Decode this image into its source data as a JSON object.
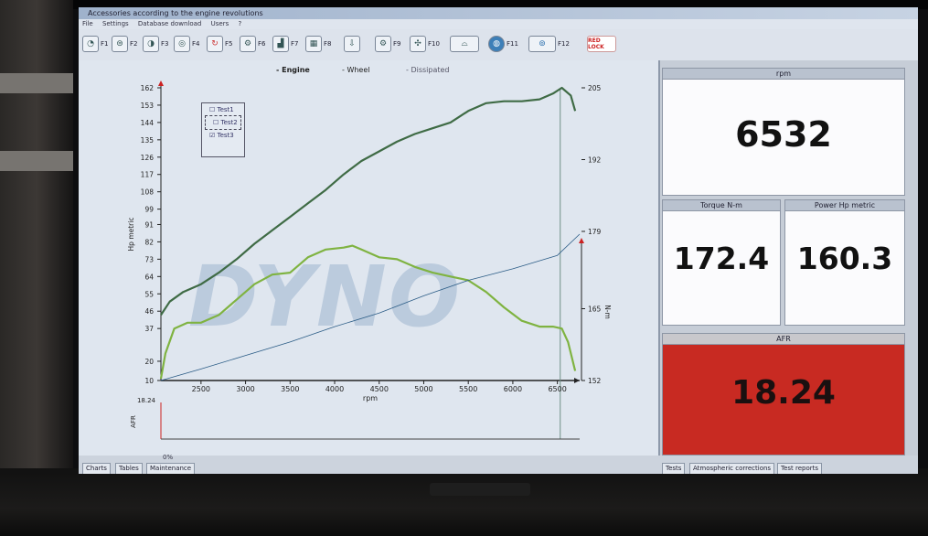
{
  "window": {
    "title": "Accessories according to the engine revolutions",
    "menu": [
      "File",
      "Settings",
      "Database download",
      "Users",
      "?"
    ]
  },
  "toolbar": {
    "buttons": [
      {
        "label": "F1",
        "icon": "speedometer-icon"
      },
      {
        "label": "F2",
        "icon": "dyno-roller-icon"
      },
      {
        "label": "F3",
        "icon": "gauge-icon"
      },
      {
        "label": "F4",
        "icon": "wheel-icon"
      },
      {
        "label": "F5",
        "icon": "reset-icon"
      },
      {
        "label": "F6",
        "icon": "engine-icon"
      },
      {
        "label": "F7",
        "icon": "chart-icon"
      },
      {
        "label": "F8",
        "icon": "table-icon"
      },
      {
        "label": "",
        "icon": "download-icon"
      },
      {
        "label": "F9",
        "icon": "settings-icon"
      },
      {
        "label": "F10",
        "icon": "tools-icon"
      },
      {
        "label": "",
        "icon": "car-icon"
      },
      {
        "label": "F11",
        "icon": "globe-icon"
      },
      {
        "label": "F12",
        "icon": "roller-icon"
      },
      {
        "label": "RED LOCK",
        "icon": "lock-icon"
      }
    ]
  },
  "chart_panel": {
    "legend": [
      "Engine",
      "Wheel",
      "Dissipated"
    ],
    "watermark": "DYNO",
    "tests": [
      {
        "label": "Test1",
        "checked": false
      },
      {
        "label": "Test2",
        "checked": false
      },
      {
        "label": "Test3",
        "checked": true
      }
    ]
  },
  "chart_data": {
    "type": "line",
    "xlabel": "rpm",
    "ylabel": "Hp metric",
    "y2label": "N-m",
    "xlim": [
      2050,
      6750
    ],
    "ylim": [
      10,
      162
    ],
    "y2lim": [
      152,
      205
    ],
    "x_ticks": [
      2500,
      3000,
      3500,
      4000,
      4500,
      5000,
      5500,
      6000,
      6500
    ],
    "y_ticks": [
      10,
      20,
      37,
      46,
      55,
      64,
      73,
      82,
      91,
      99,
      108,
      117,
      126,
      135,
      144,
      153,
      162
    ],
    "y2_ticks": [
      152,
      165,
      179,
      192,
      205
    ],
    "cursor_rpm": 6532,
    "series": [
      {
        "name": "Engine",
        "color": "#3f6b45",
        "x": [
          2050,
          2150,
          2300,
          2500,
          2700,
          2900,
          3100,
          3300,
          3500,
          3700,
          3900,
          4100,
          4300,
          4500,
          4700,
          4900,
          5100,
          5300,
          5500,
          5700,
          5900,
          6100,
          6300,
          6450,
          6550,
          6650,
          6700
        ],
        "values": [
          44,
          51,
          56,
          60,
          66,
          73,
          81,
          88,
          95,
          102,
          109,
          117,
          124,
          129,
          134,
          138,
          141,
          144,
          150,
          154,
          155,
          155,
          156,
          159,
          162,
          158,
          150
        ]
      },
      {
        "name": "Wheel",
        "color": "#7fb341",
        "x": [
          2050,
          2100,
          2200,
          2350,
          2500,
          2700,
          2900,
          3100,
          3300,
          3500,
          3700,
          3900,
          4100,
          4200,
          4300,
          4500,
          4700,
          4900,
          5100,
          5300,
          5500,
          5700,
          5900,
          6100,
          6300,
          6450,
          6550,
          6620,
          6700
        ],
        "values": [
          11,
          24,
          37,
          40,
          40,
          44,
          52,
          60,
          65,
          66,
          74,
          78,
          79,
          80,
          78,
          74,
          73,
          69,
          66,
          64,
          62,
          56,
          48,
          41,
          38,
          38,
          37,
          30,
          15
        ]
      },
      {
        "name": "Dissipated",
        "color": "#2b5c86",
        "x": [
          2050,
          2500,
          3000,
          3500,
          4000,
          4500,
          5000,
          5500,
          6000,
          6500,
          6750
        ],
        "values": [
          10,
          16,
          23,
          30,
          38,
          45,
          54,
          62,
          68,
          75,
          86
        ]
      }
    ],
    "afr_strip": {
      "label": "AFR",
      "max_label": "18.24"
    }
  },
  "gauges": {
    "rpm": {
      "label": "rpm",
      "value": "6532"
    },
    "torque": {
      "label": "Torque N-m",
      "value": "172.4"
    },
    "power": {
      "label": "Power Hp metric",
      "value": "160.3"
    },
    "afr": {
      "label": "AFR",
      "value": "18.24",
      "color": "#c82a22"
    }
  },
  "bottom_tabs": {
    "left": [
      "Charts",
      "Tables",
      "Maintenance"
    ],
    "right": [
      "Tests",
      "Atmospheric corrections",
      "Test reports"
    ],
    "status_text": "0%"
  }
}
